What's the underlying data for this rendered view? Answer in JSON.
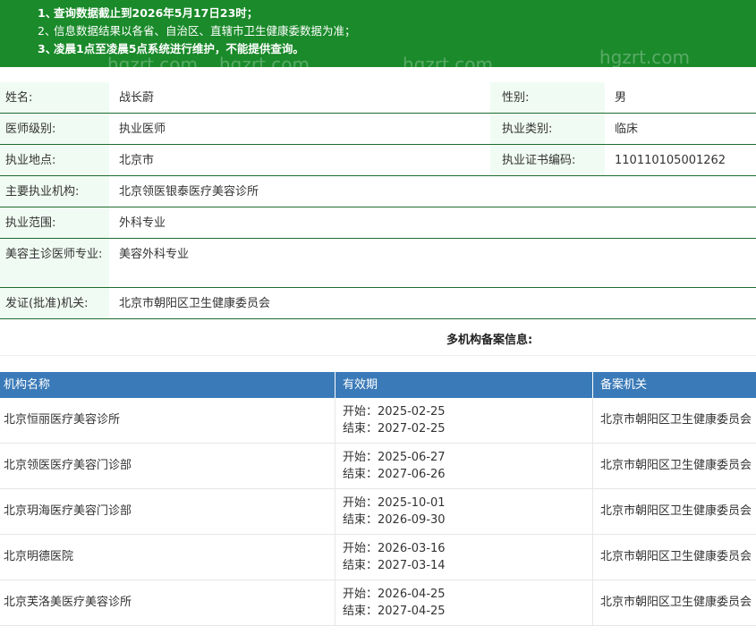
{
  "notice": {
    "lines": [
      {
        "num": "1、",
        "text": "查询数据截止到2026年5月17日23时；",
        "bold": true
      },
      {
        "num": "2、",
        "text": "信息数据结果以各省、自治区、直辖市卫生健康委数据为准；",
        "bold": false
      },
      {
        "num": "3、",
        "text": "凌晨1点至凌晨5点系统进行维护，不能提供查询。",
        "bold": true
      }
    ],
    "watermark": "hgzrt.com"
  },
  "doctor": {
    "name_label": "姓名:",
    "name": "战长蔚",
    "gender_label": "性别:",
    "gender": "男",
    "level_label": "医师级别:",
    "level": "执业医师",
    "category_label": "执业类别:",
    "category": "临床",
    "location_label": "执业地点:",
    "location": "北京市",
    "cert_label": "执业证书编码:",
    "cert_no": "110110105001262",
    "institution_label": "主要执业机构:",
    "institution": "北京领医银泰医疗美容诊所",
    "scope_label": "执业范围:",
    "scope": "外科专业",
    "cosmetic_label": "美容主诊医师专业:",
    "cosmetic": "美容外科专业",
    "authority_label": "发证(批准)机关:",
    "authority": "北京市朝阳区卫生健康委员会"
  },
  "multi": {
    "title": "多机构备案信息:",
    "headers": [
      "机构名称",
      "有效期",
      "备案机关"
    ],
    "rows": [
      {
        "name": "北京恒丽医疗美容诊所",
        "start": "开始：2025-02-25",
        "end": "结束：2027-02-25",
        "authority": "北京市朝阳区卫生健康委员会"
      },
      {
        "name": "北京领医医疗美容门诊部",
        "start": "开始：2025-06-27",
        "end": "结束：2027-06-26",
        "authority": "北京市朝阳区卫生健康委员会"
      },
      {
        "name": "北京玥海医疗美容门诊部",
        "start": "开始：2025-10-01",
        "end": "结束：2026-09-30",
        "authority": "北京市朝阳区卫生健康委员会"
      },
      {
        "name": "北京明德医院",
        "start": "开始：2026-03-16",
        "end": "结束：2027-03-14",
        "authority": "北京市朝阳区卫生健康委员会"
      },
      {
        "name": "北京芙洛美医疗美容诊所",
        "start": "开始：2026-04-25",
        "end": "结束：2027-04-25",
        "authority": "北京市朝阳区卫生健康委员会"
      }
    ]
  },
  "colors": {
    "notice_bg": "#1a8a2a",
    "header_bg": "#3a7ab8",
    "label_bg": "#f0fbf3",
    "row_border": "#1e6b2e"
  }
}
